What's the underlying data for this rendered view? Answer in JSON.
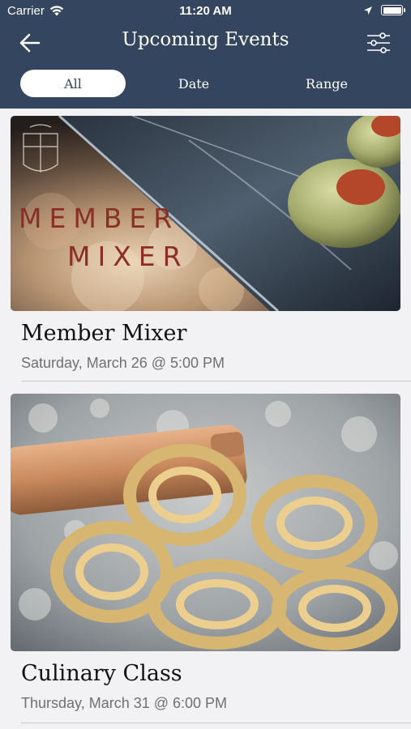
{
  "status": {
    "carrier": "Carrier",
    "time": "11:20 AM"
  },
  "nav": {
    "title": "Upcoming Events"
  },
  "tabs": [
    {
      "label": "All",
      "active": true
    },
    {
      "label": "Date",
      "active": false
    },
    {
      "label": "Range",
      "active": false
    }
  ],
  "events": [
    {
      "image_text_line1": "MEMBER",
      "image_text_line2": "MIXER",
      "title": "Member Mixer",
      "date": "Saturday, March 26 @ 5:00 PM"
    },
    {
      "title": "Culinary Class",
      "date": "Thursday, March 31 @ 6:00 PM"
    }
  ],
  "colors": {
    "header": "#34465f",
    "accent_text": "#7a2b25",
    "background": "#f2f2f5"
  }
}
